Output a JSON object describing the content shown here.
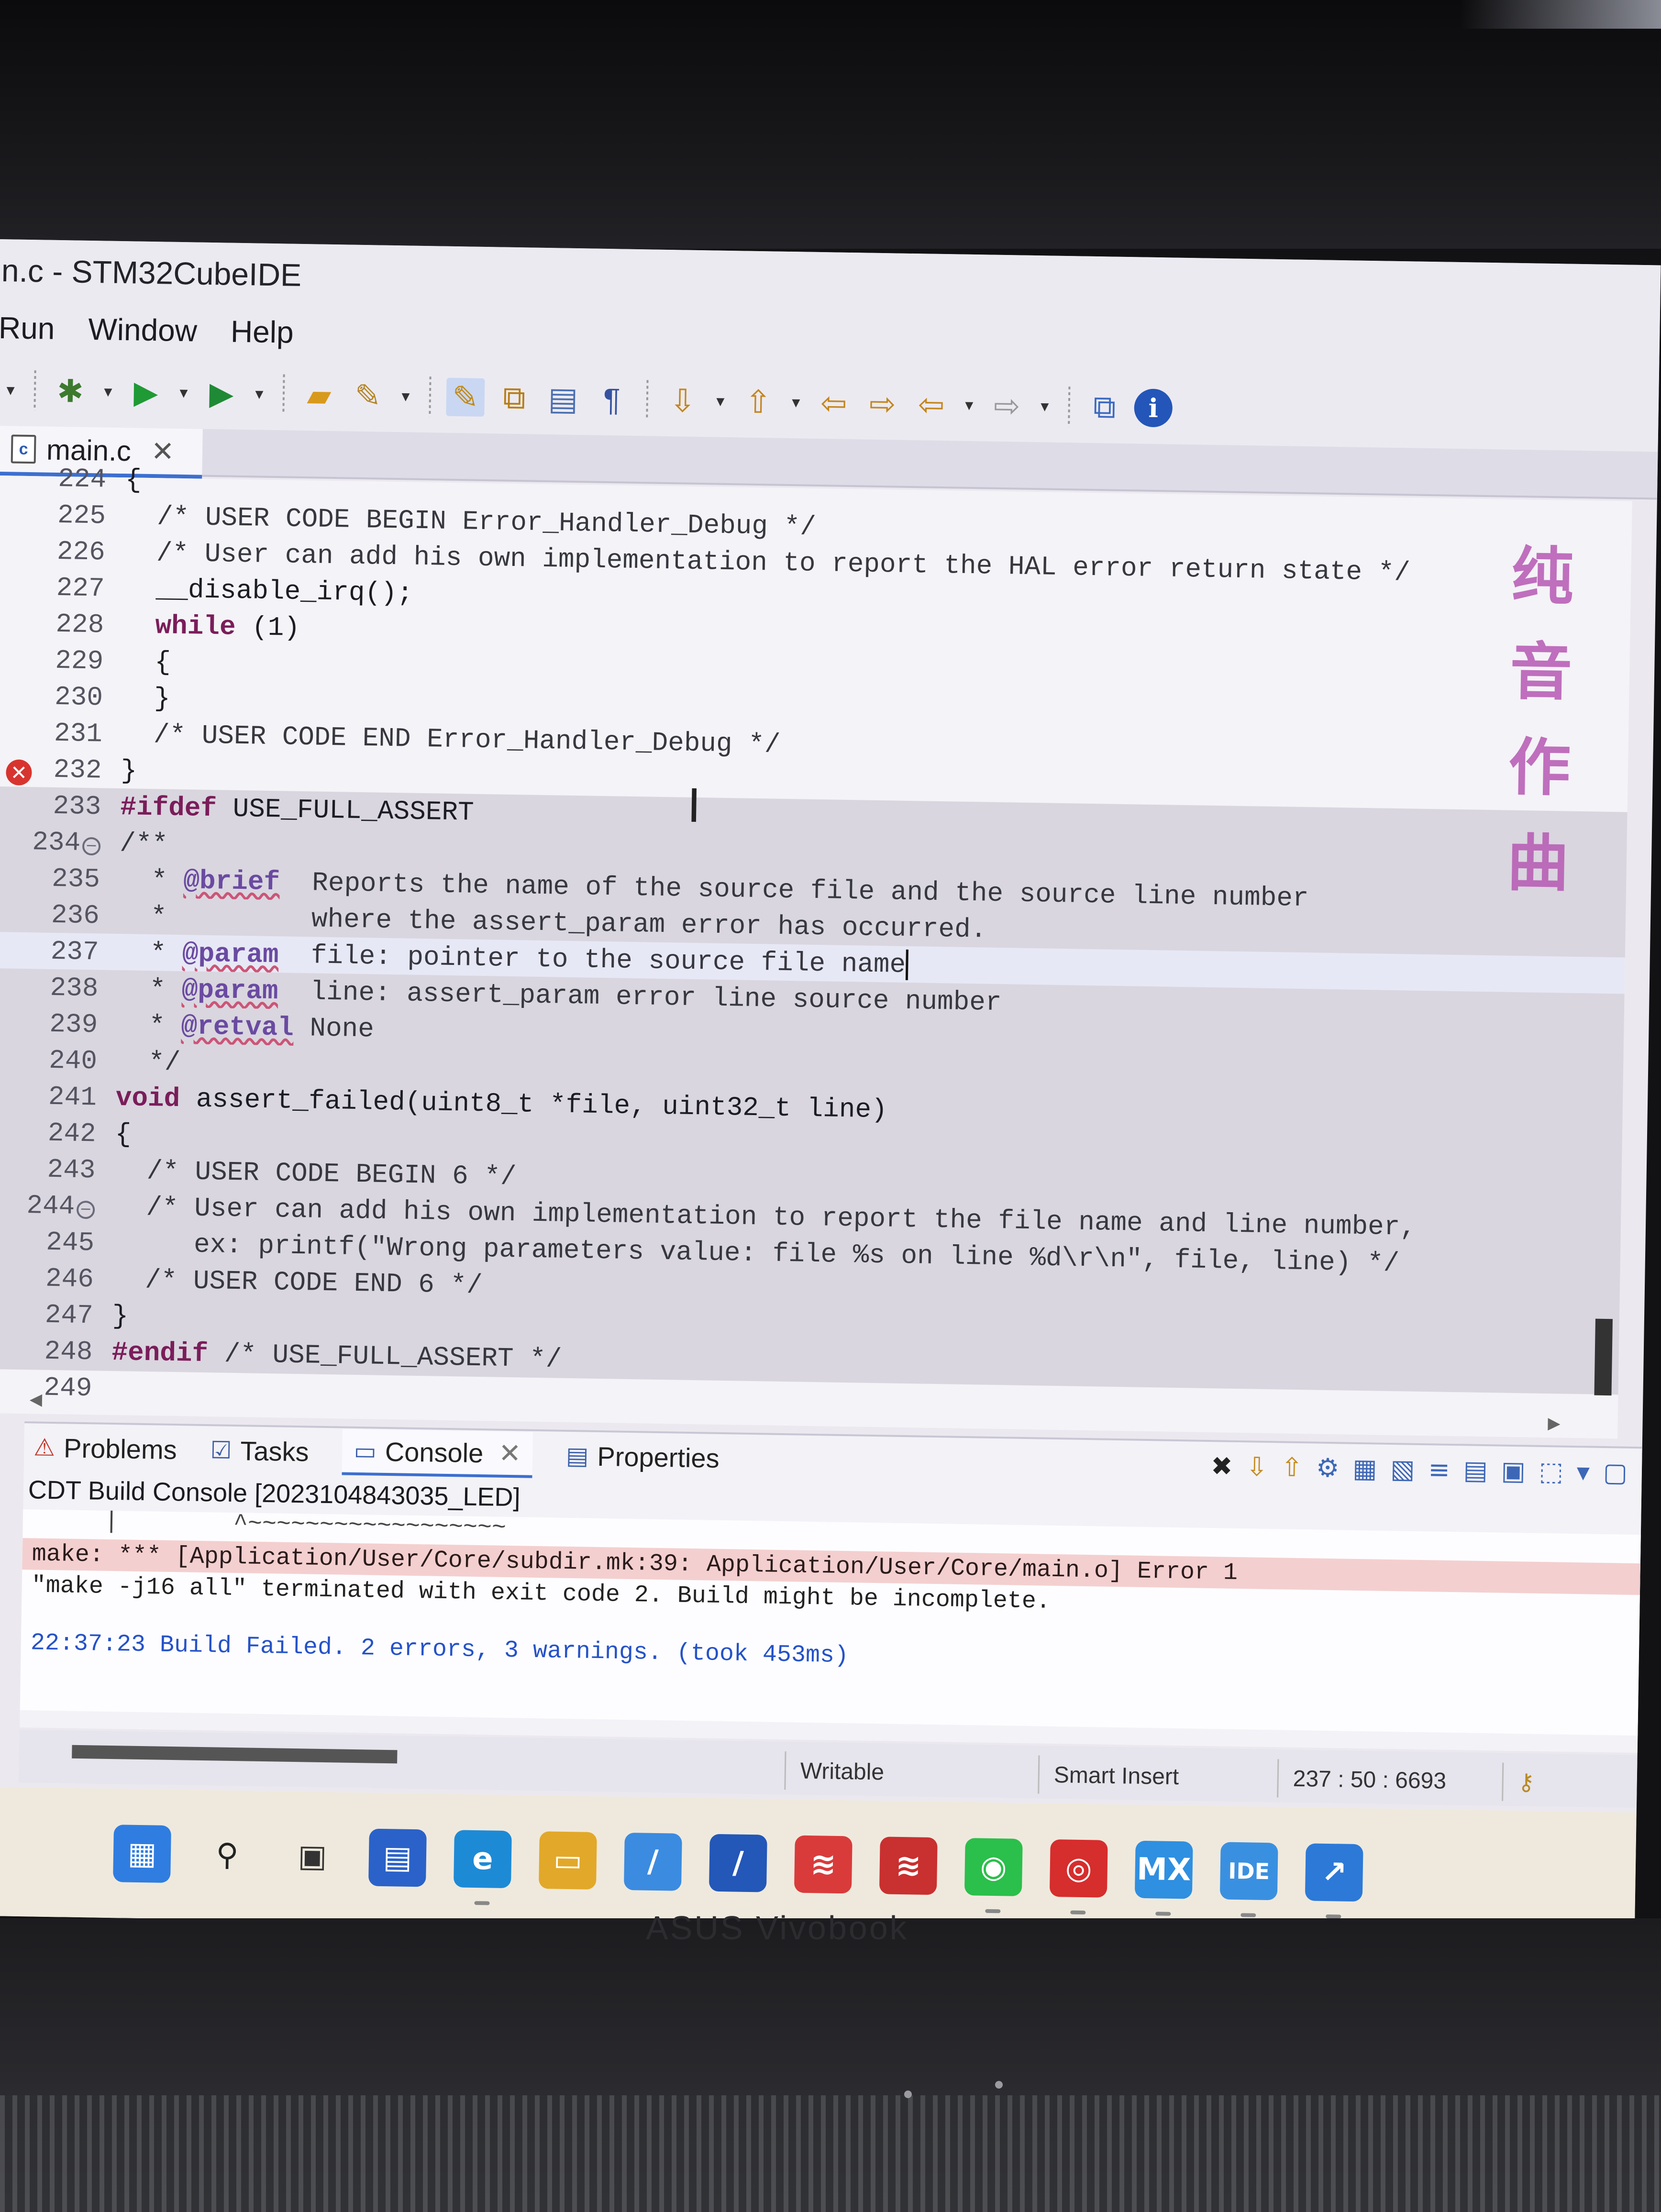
{
  "window": {
    "title": "n.c - STM32CubeIDE"
  },
  "menu": [
    "Run",
    "Window",
    "Help"
  ],
  "toolbar": {
    "icons": [
      "debug-bug-icon",
      "run-icon",
      "run-config-icon",
      "open-folder-icon",
      "build-wrench-icon",
      "highlight-pen-icon",
      "link-icon",
      "doc-icon",
      "pilcrow-icon",
      "next-annotation-icon",
      "prev-annotation-icon",
      "back-icon",
      "forward-icon",
      "left-arrow-icon",
      "right-arrow-icon",
      "new-window-icon",
      "info-icon"
    ]
  },
  "editor": {
    "tab_label": "main.c",
    "tab_icon_letter": "c",
    "watermark_line1": "纯音",
    "watermark_line2": "作曲",
    "lines": [
      {
        "n": "224",
        "t": "{"
      },
      {
        "n": "225",
        "t": "  /* USER CODE BEGIN Error_Handler_Debug */"
      },
      {
        "n": "226",
        "t": "  /* User can add his own implementation to report the HAL error return state */"
      },
      {
        "n": "227",
        "t": "  __disable_irq();"
      },
      {
        "n": "228",
        "t": "  while (1)"
      },
      {
        "n": "229",
        "t": "  {"
      },
      {
        "n": "230",
        "t": "  }"
      },
      {
        "n": "231",
        "t": "  /* USER CODE END Error_Handler_Debug */"
      },
      {
        "n": "232",
        "t": "}"
      },
      {
        "n": "233",
        "t": "#ifdef USE_FULL_ASSERT"
      },
      {
        "n": "234",
        "t": "/**"
      },
      {
        "n": "235",
        "t": "  * @brief  Reports the name of the source file and the source line number"
      },
      {
        "n": "236",
        "t": "  *         where the assert_param error has occurred."
      },
      {
        "n": "237",
        "t": "  * @param  file: pointer to the source file name"
      },
      {
        "n": "238",
        "t": "  * @param  line: assert_param error line source number"
      },
      {
        "n": "239",
        "t": "  * @retval None"
      },
      {
        "n": "240",
        "t": "  */"
      },
      {
        "n": "241",
        "t": "void assert_failed(uint8_t *file, uint32_t line)"
      },
      {
        "n": "242",
        "t": "{"
      },
      {
        "n": "243",
        "t": "  /* USER CODE BEGIN 6 */"
      },
      {
        "n": "244",
        "t": "  /* User can add his own implementation to report the file name and line number,"
      },
      {
        "n": "245",
        "t": "     ex: printf(\"Wrong parameters value: file %s on line %d\\r\\n\", file, line) */"
      },
      {
        "n": "246",
        "t": "  /* USER CODE END 6 */"
      },
      {
        "n": "247",
        "t": "}"
      },
      {
        "n": "248",
        "t": "#endif /* USE_FULL_ASSERT */"
      },
      {
        "n": "249",
        "t": ""
      }
    ]
  },
  "panel": {
    "tabs": [
      "Problems",
      "Tasks",
      "Console",
      "Properties"
    ],
    "console_title": "CDT Build Console [2023104843035_LED]",
    "console_lines": [
      {
        "text": "     |        ^~~~~~~~~~~~~~~~~~~",
        "kind": "squiggle"
      },
      {
        "text": "make: *** [Application/User/Core/subdir.mk:39: Application/User/Core/main.o] Error 1",
        "kind": "err"
      },
      {
        "text": "\"make -j16 all\" terminated with exit code 2. Build might be incomplete.",
        "kind": "black"
      },
      {
        "text": "",
        "kind": "black"
      },
      {
        "text": "22:37:23 Build Failed. 2 errors, 3 warnings. (took 453ms)",
        "kind": "status"
      }
    ]
  },
  "status": {
    "writable": "Writable",
    "insert_mode": "Smart Insert",
    "position": "237 : 50 : 6693"
  },
  "taskbar": {
    "apps": [
      {
        "name": "start",
        "glyph": "▦",
        "color": "#2f7de1"
      },
      {
        "name": "search",
        "glyph": "⚲",
        "color": "#222222"
      },
      {
        "name": "task-view",
        "glyph": "▣",
        "color": "#333333"
      },
      {
        "name": "store",
        "glyph": "▤",
        "color": "#2a62c9"
      },
      {
        "name": "edge",
        "glyph": "e",
        "color": "#1d8ad6"
      },
      {
        "name": "file-explorer",
        "glyph": "▭",
        "color": "#e2a829"
      },
      {
        "name": "app-1",
        "glyph": "/",
        "color": "#3b8be0"
      },
      {
        "name": "app-2",
        "glyph": "/",
        "color": "#2357b8"
      },
      {
        "name": "app-3",
        "glyph": "≋",
        "color": "#d93b3b"
      },
      {
        "name": "app-4",
        "glyph": "≋",
        "color": "#c93030"
      },
      {
        "name": "wechat",
        "glyph": "◉",
        "color": "#2bbf4b"
      },
      {
        "name": "netease-music",
        "glyph": "◎",
        "color": "#d62d2d"
      },
      {
        "name": "stm32cubemx",
        "glyph": "MX",
        "color": "#2f8fe0"
      },
      {
        "name": "stm32cubeide",
        "glyph": "IDE",
        "color": "#3a90e0"
      },
      {
        "name": "app-5",
        "glyph": "↗",
        "color": "#2c79d8"
      }
    ]
  }
}
